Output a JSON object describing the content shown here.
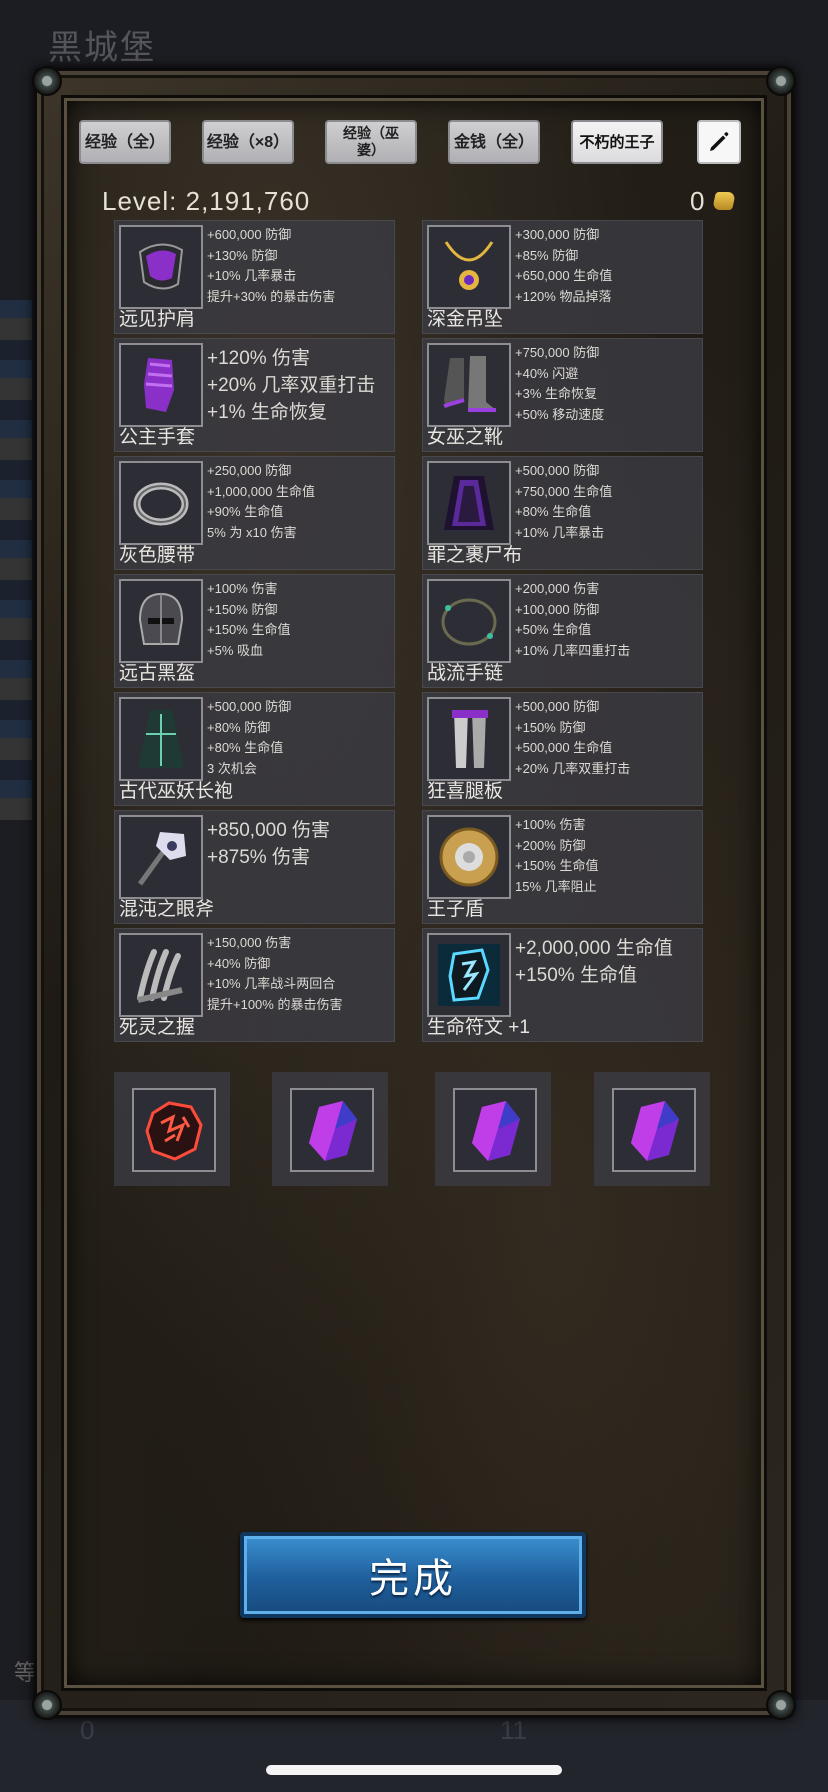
{
  "background": {
    "location_title": "黑城堡",
    "bottom_left_char": "等",
    "bottom_counts": [
      "0",
      "11"
    ]
  },
  "top_buttons": [
    {
      "label": "经验（全）"
    },
    {
      "label": "经验（×8）"
    },
    {
      "label": "经验（巫婆）"
    },
    {
      "label": "金钱（全）"
    },
    {
      "label": "不朽的王子"
    }
  ],
  "edit_icon": "pencil-icon",
  "header": {
    "level_text": "Level: 2,191,760",
    "gold_count": "0"
  },
  "items": [
    {
      "name": "远见护肩",
      "icon": "purple-shoulder-icon",
      "big": false,
      "stats": [
        "+600,000 防御",
        "+130% 防御",
        "+10% 几率暴击",
        "提升+30% 的暴击伤害"
      ]
    },
    {
      "name": "深金吊坠",
      "icon": "gold-pendant-icon",
      "big": false,
      "stats": [
        "+300,000 防御",
        "+85% 防御",
        "+650,000 生命值",
        "+120% 物品掉落"
      ]
    },
    {
      "name": "公主手套",
      "icon": "purple-gauntlet-icon",
      "big": true,
      "stats": [
        "+120% 伤害",
        "+20% 几率双重打击",
        "+1% 生命恢复"
      ]
    },
    {
      "name": "女巫之靴",
      "icon": "witch-boots-icon",
      "big": false,
      "stats": [
        "+750,000 防御",
        "+40% 闪避",
        "+3% 生命恢复",
        "+50% 移动速度"
      ]
    },
    {
      "name": "灰色腰带",
      "icon": "grey-belt-icon",
      "big": false,
      "stats": [
        "+250,000 防御",
        "+1,000,000 生命值",
        "+90% 生命值",
        "5% 为 x10 伤害"
      ]
    },
    {
      "name": "罪之裹尸布",
      "icon": "shroud-cloak-icon",
      "big": false,
      "stats": [
        "+500,000 防御",
        "+750,000 生命值",
        "+80% 生命值",
        "+10% 几率暴击"
      ]
    },
    {
      "name": "远古黑盔",
      "icon": "black-helmet-icon",
      "big": false,
      "stats": [
        "+100% 伤害",
        "+150% 防御",
        "+150% 生命值",
        "+5% 吸血"
      ]
    },
    {
      "name": "战流手链",
      "icon": "bracelet-icon",
      "big": false,
      "stats": [
        "+200,000 伤害",
        "+100,000 防御",
        "+50% 生命值",
        "+10% 几率四重打击"
      ]
    },
    {
      "name": "古代巫妖长袍",
      "icon": "lich-robe-icon",
      "big": false,
      "stats": [
        "+500,000 防御",
        "+80% 防御",
        "+80% 生命值",
        "3 次机会"
      ]
    },
    {
      "name": "狂喜腿板",
      "icon": "leg-armor-icon",
      "big": false,
      "stats": [
        "+500,000 防御",
        "+150% 防御",
        "+500,000 生命值",
        "+20% 几率双重打击"
      ]
    },
    {
      "name": "混沌之眼斧",
      "icon": "chaos-axe-icon",
      "big": true,
      "stats": [
        "+850,000 伤害",
        "+875% 伤害"
      ]
    },
    {
      "name": "王子盾",
      "icon": "round-shield-icon",
      "big": false,
      "stats": [
        "+100% 伤害",
        "+200% 防御",
        "+150% 生命值",
        "15% 几率阻止"
      ]
    },
    {
      "name": "死灵之握",
      "icon": "bone-claw-icon",
      "big": false,
      "stats": [
        "+150,000 伤害",
        "+40% 防御",
        "+10% 几率战斗两回合",
        "提升+100% 的暴击伤害"
      ]
    },
    {
      "name": "生命符文 +1",
      "icon": "life-rune-icon",
      "big": true,
      "stats": [
        "+2,000,000 生命值",
        "+150% 生命值"
      ]
    }
  ],
  "gems": [
    {
      "icon": "red-rune-stone-icon"
    },
    {
      "icon": "purple-crystal-icon"
    },
    {
      "icon": "purple-crystal-icon"
    },
    {
      "icon": "purple-crystal-icon"
    }
  ],
  "done_button": {
    "label": "完成"
  },
  "colors": {
    "accent_blue": "#2a74b8",
    "gold": "#e4b640",
    "card_bg": "#3a3a42"
  }
}
